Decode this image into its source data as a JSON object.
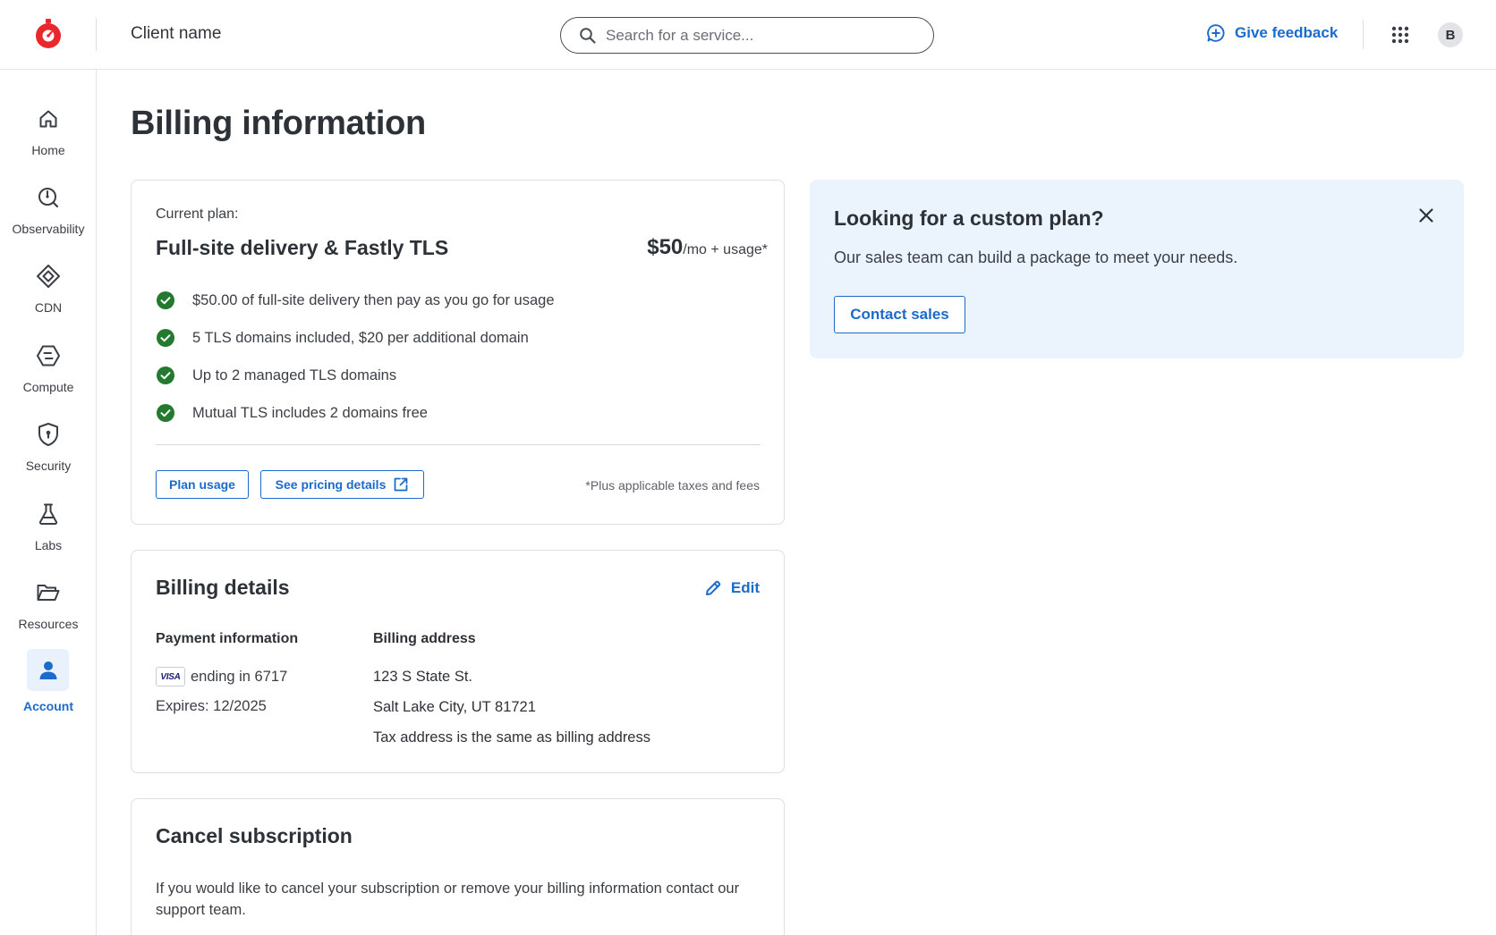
{
  "header": {
    "client_name": "Client name",
    "search_placeholder": "Search for a service...",
    "feedback_label": "Give feedback",
    "avatar_initial": "B",
    "brand_color": "#e8282b",
    "accent_color": "#1b6bcc"
  },
  "sidebar": {
    "items": [
      {
        "label": "Home",
        "icon": "home-icon"
      },
      {
        "label": "Observability",
        "icon": "observability-icon"
      },
      {
        "label": "CDN",
        "icon": "cdn-icon"
      },
      {
        "label": "Compute",
        "icon": "compute-icon"
      },
      {
        "label": "Security",
        "icon": "security-icon"
      },
      {
        "label": "Labs",
        "icon": "labs-flask-icon"
      },
      {
        "label": "Resources",
        "icon": "folder-icon"
      },
      {
        "label": "Account",
        "icon": "account-icon",
        "active": true
      }
    ]
  },
  "main": {
    "title": "Billing information",
    "plan": {
      "current_label": "Current plan:",
      "name": "Full-site delivery & Fastly TLS",
      "price": "$50",
      "price_suffix": "/mo + usage*",
      "features": [
        "$50.00 of full-site delivery then pay as you go for usage",
        "5 TLS domains included, $20 per additional domain",
        "Up to 2 managed TLS domains",
        "Mutual TLS includes 2 domains free"
      ],
      "plan_usage_label": "Plan usage",
      "pricing_label": "See pricing details",
      "taxes_note": "*Plus applicable taxes and fees"
    },
    "billing": {
      "heading": "Billing details",
      "edit_label": "Edit",
      "payment_heading": "Payment information",
      "card_brand": "VISA",
      "card_ending": "ending in 6717",
      "expires": "Expires: 12/2025",
      "address_heading": "Billing address",
      "address_line1": "123 S State St.",
      "address_line2": "Salt Lake City, UT 81721",
      "tax_note": "Tax address is the same as billing address"
    },
    "cancel": {
      "heading": "Cancel subscription",
      "text": "If you would like to cancel your subscription or remove your billing information contact our support team."
    }
  },
  "promo": {
    "title": "Looking for a custom plan?",
    "text": "Our sales team can build a package to meet your needs.",
    "button_label": "Contact sales"
  }
}
